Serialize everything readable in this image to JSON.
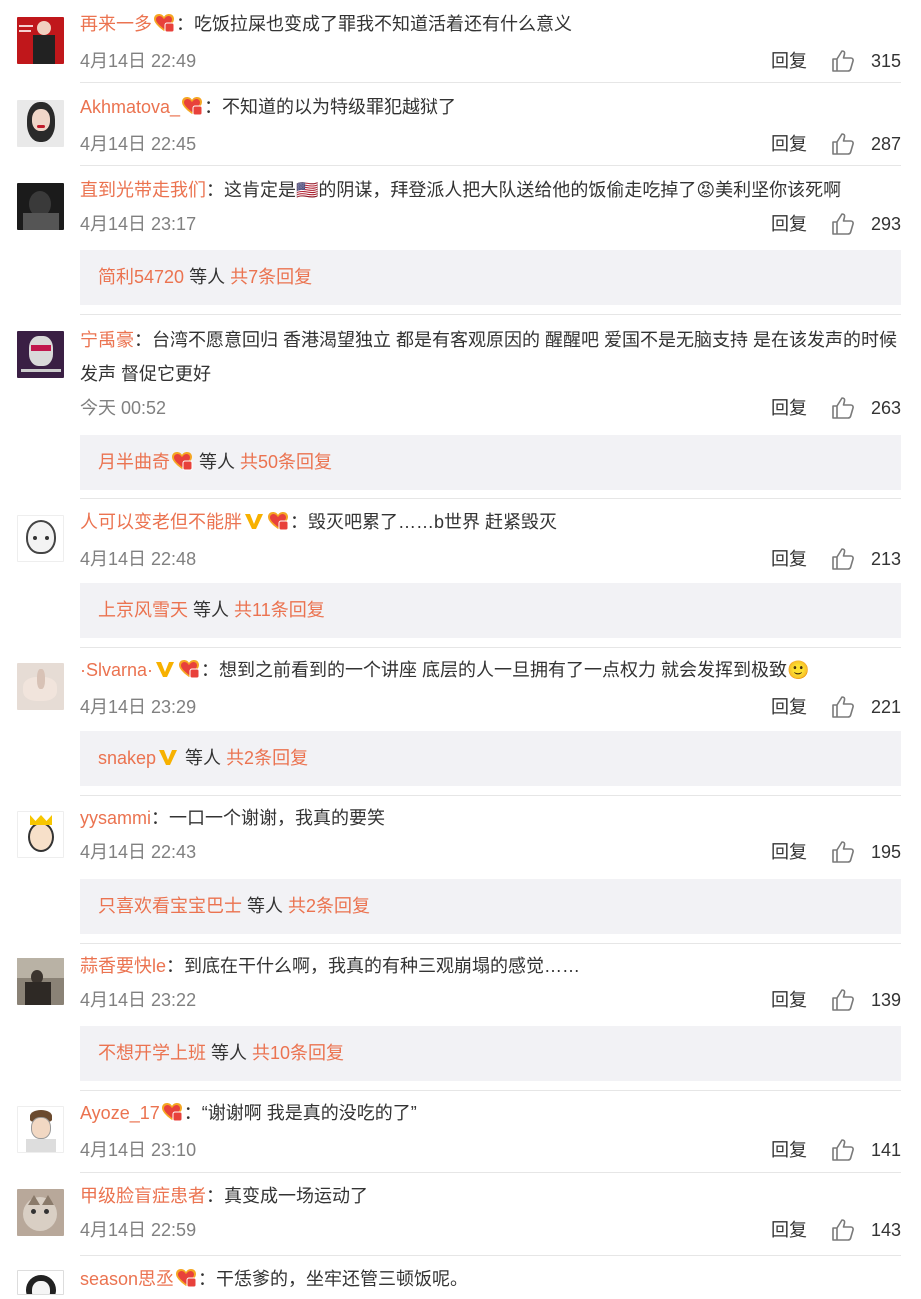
{
  "comments": [
    {
      "user": "再来一多",
      "text": "：吃饭拉屎也变成了罪我不知道活着还有什么意义",
      "time": "4月14日 22:49",
      "reply": "回复",
      "likes": "315"
    },
    {
      "user": "Akhmatova_",
      "text": "：不知道的以为特级罪犯越狱了",
      "time": "4月14日 22:45",
      "reply": "回复",
      "likes": "287"
    },
    {
      "user": "直到光带走我们",
      "text": "：这肯定是🇺🇸的阴谋，拜登派人把大队送给他的饭偷走吃掉了😡美利坚你该死啊",
      "time": "4月14日 23:17",
      "reply": "回复",
      "likes": "293",
      "sub": {
        "user": "简利54720",
        "mid": " 等人 ",
        "total": "共7条回复"
      }
    },
    {
      "user": "宁禹豪",
      "text": "：台湾不愿意回归 香港渴望独立 都是有客观原因的 醒醒吧 爱国不是无脑支持 是在该发声的时候发声 督促它更好",
      "time": "今天 00:52",
      "reply": "回复",
      "likes": "263",
      "sub": {
        "user": "月半曲奇",
        "mid": " 等人 ",
        "total": "共50条回复"
      }
    },
    {
      "user": "人可以变老但不能胖",
      "text": "：毁灭吧累了……b世界 赶紧毁灭",
      "time": "4月14日 22:48",
      "reply": "回复",
      "likes": "213",
      "sub": {
        "user": "上京风雪天",
        "mid": " 等人 ",
        "total": "共11条回复"
      }
    },
    {
      "user": "·Slvarna·",
      "text": "：想到之前看到的一个讲座 底层的人一旦拥有了一点权力 就会发挥到极致🙂",
      "time": "4月14日 23:29",
      "reply": "回复",
      "likes": "221",
      "sub": {
        "user": "snakep",
        "mid": " 等人 ",
        "total": "共2条回复"
      }
    },
    {
      "user": "yysammi",
      "text": "：一口一个谢谢，我真的要笑",
      "time": "4月14日 22:43",
      "reply": "回复",
      "likes": "195",
      "sub": {
        "user": "只喜欢看宝宝巴士",
        "mid": " 等人 ",
        "total": "共2条回复"
      }
    },
    {
      "user": "蒜香要快le",
      "text": "：到底在干什么啊，我真的有种三观崩塌的感觉……",
      "time": "4月14日 23:22",
      "reply": "回复",
      "likes": "139",
      "sub": {
        "user": "不想开学上班",
        "mid": " 等人 ",
        "total": "共10条回复"
      }
    },
    {
      "user": "Ayoze_17",
      "text": "：“谢谢啊 我是真的没吃的了”",
      "time": "4月14日 23:10",
      "reply": "回复",
      "likes": "141"
    },
    {
      "user": "甲级脸盲症患者",
      "text": "：真变成一场运动了",
      "time": "4月14日 22:59",
      "reply": "回复",
      "likes": "143"
    },
    {
      "user": "season思丞",
      "text": "：干恁爹的，坐牢还管三顿饭呢。"
    }
  ],
  "colors": {
    "username": "#eb7350",
    "subbox": "#f2f2f5",
    "timestamp": "#808080"
  }
}
